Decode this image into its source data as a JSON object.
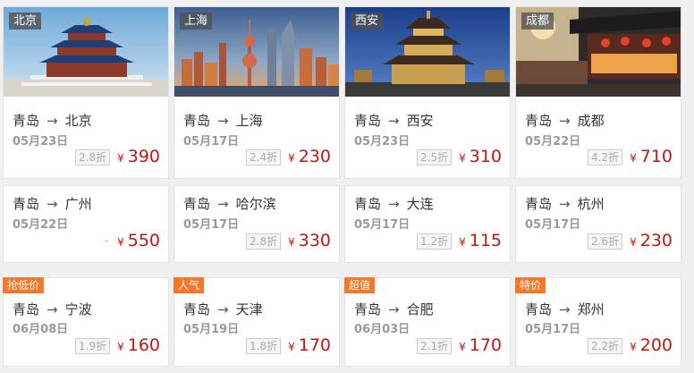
{
  "cards": [
    {
      "city_tag": "北京",
      "from": "青岛",
      "arrow": "→",
      "to": "北京",
      "date": "05月23日",
      "discount": "2.8折",
      "currency": "¥",
      "price": "390"
    },
    {
      "city_tag": "上海",
      "from": "青岛",
      "arrow": "→",
      "to": "上海",
      "date": "05月17日",
      "discount": "2.4折",
      "currency": "¥",
      "price": "230"
    },
    {
      "city_tag": "西安",
      "from": "青岛",
      "arrow": "→",
      "to": "西安",
      "date": "05月23日",
      "discount": "2.5折",
      "currency": "¥",
      "price": "310"
    },
    {
      "city_tag": "成都",
      "from": "青岛",
      "arrow": "→",
      "to": "成都",
      "date": "05月22日",
      "discount": "4.2折",
      "currency": "¥",
      "price": "710"
    },
    {
      "from": "青岛",
      "arrow": "→",
      "to": "广州",
      "date": "05月22日",
      "discount": "-",
      "currency": "¥",
      "price": "550"
    },
    {
      "from": "青岛",
      "arrow": "→",
      "to": "哈尔滨",
      "date": "05月17日",
      "discount": "2.8折",
      "currency": "¥",
      "price": "330"
    },
    {
      "from": "青岛",
      "arrow": "→",
      "to": "大连",
      "date": "05月17日",
      "discount": "1.2折",
      "currency": "¥",
      "price": "115"
    },
    {
      "from": "青岛",
      "arrow": "→",
      "to": "杭州",
      "date": "05月17日",
      "discount": "2.6折",
      "currency": "¥",
      "price": "230"
    },
    {
      "promo": "抢低价",
      "from": "青岛",
      "arrow": "→",
      "to": "宁波",
      "date": "06月08日",
      "discount": "1.9折",
      "currency": "¥",
      "price": "160"
    },
    {
      "promo": "人气",
      "from": "青岛",
      "arrow": "→",
      "to": "天津",
      "date": "05月19日",
      "discount": "1.8折",
      "currency": "¥",
      "price": "170"
    },
    {
      "promo": "超值",
      "from": "青岛",
      "arrow": "→",
      "to": "合肥",
      "date": "06月03日",
      "discount": "2.1折",
      "currency": "¥",
      "price": "170"
    },
    {
      "promo": "特价",
      "from": "青岛",
      "arrow": "→",
      "to": "郑州",
      "date": "05月17日",
      "discount": "2.2折",
      "currency": "¥",
      "price": "200"
    }
  ],
  "colors": {
    "price": "#c0170e",
    "promo": "#f3782b",
    "tag": "#555555"
  }
}
